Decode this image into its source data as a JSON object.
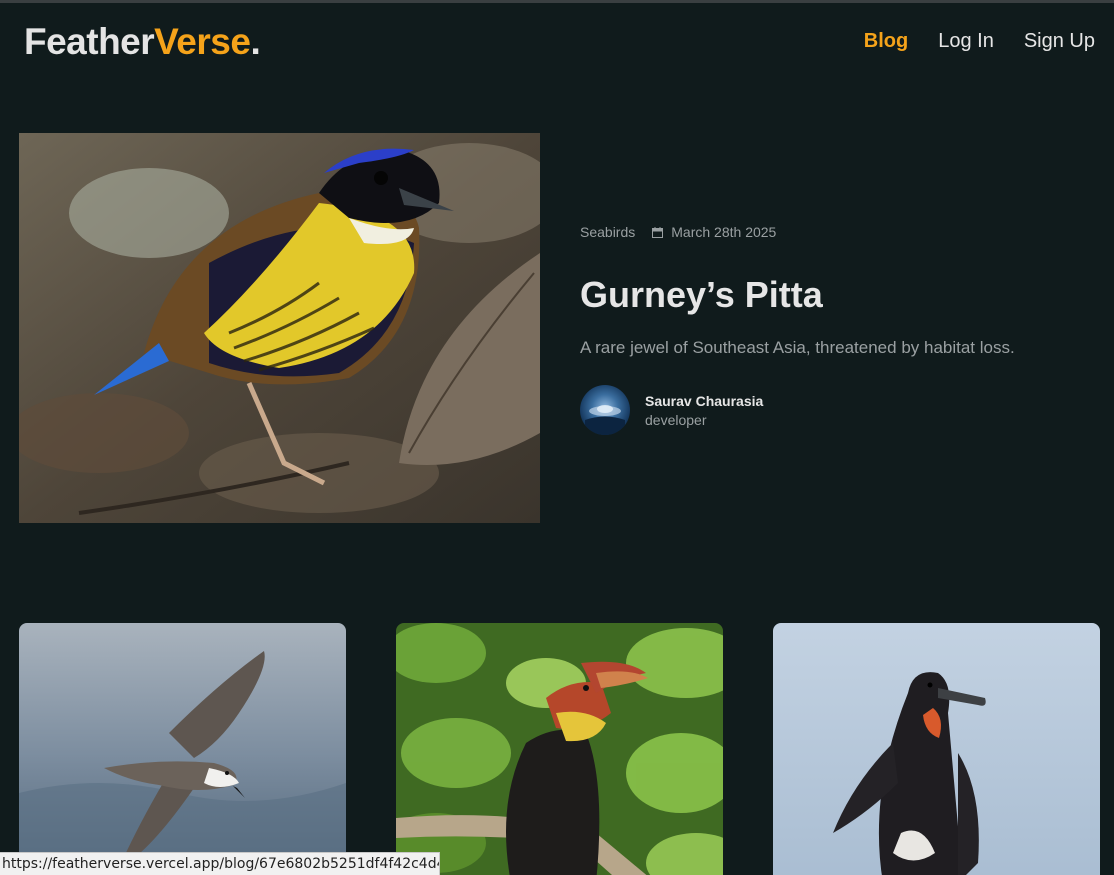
{
  "brand": {
    "part1": "Feather",
    "part2": "Verse",
    "dot": "."
  },
  "nav": [
    {
      "label": "Blog",
      "active": true
    },
    {
      "label": "Log In",
      "active": false
    },
    {
      "label": "Sign Up",
      "active": false
    }
  ],
  "featured": {
    "category": "Seabirds",
    "date": "March 28th 2025",
    "title": "Gurney’s Pitta",
    "description": "A rare jewel of Southeast Asia, threatened by habitat loss.",
    "author": {
      "name": "Saurav Chaurasia",
      "role": "developer"
    },
    "image": "gurneys-pitta-photo"
  },
  "cards": [
    {
      "image": "petrel-in-flight-photo"
    },
    {
      "image": "hornbill-on-branch-photo"
    },
    {
      "image": "frigatebird-photo"
    }
  ],
  "status_url": "https://featherverse.vercel.app/blog/67e6802b5251df4f42c4d415",
  "colors": {
    "background": "#101b1c",
    "accent": "#f5a31a",
    "muted": "#9aa0a2"
  }
}
